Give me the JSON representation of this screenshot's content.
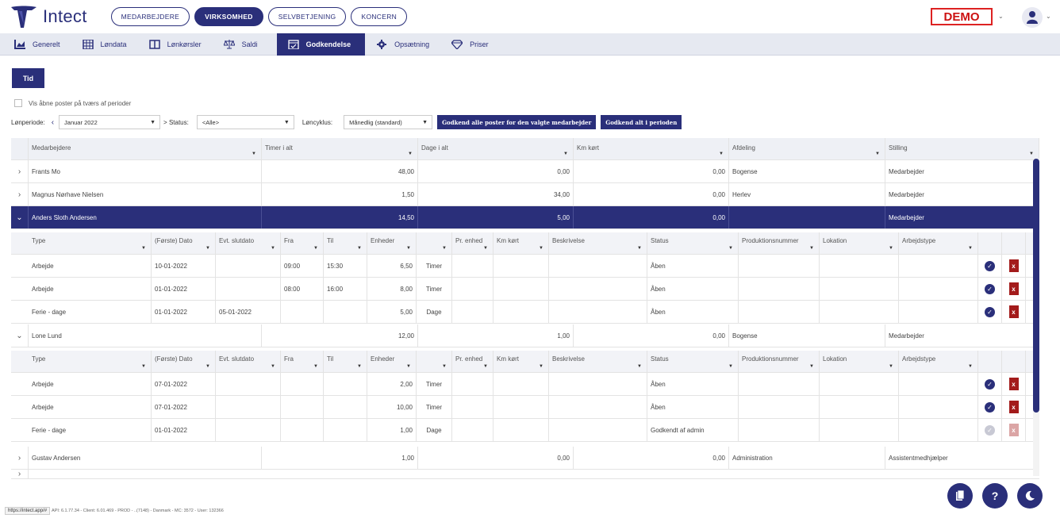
{
  "app": {
    "name": "Intect",
    "demo": "DEMO"
  },
  "top_tabs": [
    "MEDARBEJDERE",
    "VIRKSOMHED",
    "SELVBETJENING",
    "KONCERN"
  ],
  "nav": [
    {
      "label": "Generelt",
      "icon": "chart-icon"
    },
    {
      "label": "Løndata",
      "icon": "table-icon"
    },
    {
      "label": "Lønkørsler",
      "icon": "book-icon"
    },
    {
      "label": "Saldi",
      "icon": "scale-icon"
    },
    {
      "label": "Godkendelse",
      "icon": "calendar-check-icon",
      "active": true
    },
    {
      "label": "Opsætning",
      "icon": "gear-icon"
    },
    {
      "label": "Priser",
      "icon": "diamond-icon"
    }
  ],
  "tid_button": "Tid",
  "filters": {
    "cross_period_label": "Vis åbne poster på tværs af perioder",
    "period_label": "Lønperiode:",
    "period_value": "Januar 2022",
    "status_label": "> Status:",
    "status_value": "<Alle>",
    "cycle_label": "Løncyklus:",
    "cycle_value": "Månedlig (standard)",
    "approve_employee_btn": "Godkend alle poster for den valgte medarbejder",
    "approve_period_btn": "Godkend alt i perioden"
  },
  "grid_headers": [
    "Medarbejdere",
    "Timer i alt",
    "Dage i alt",
    "Km kørt",
    "Afdeling",
    "Stilling"
  ],
  "employees": [
    {
      "name": "Frants Mo",
      "hours": "48,00",
      "days": "0,00",
      "km": "0,00",
      "dept": "Bogense",
      "role": "Medarbejder"
    },
    {
      "name": "Magnus Nørhave Nielsen",
      "hours": "1,50",
      "days": "34,00",
      "km": "0,00",
      "dept": "Herlev",
      "role": "Medarbejder"
    },
    {
      "name": "Anders Sloth Andersen",
      "hours": "14,50",
      "days": "5,00",
      "km": "0,00",
      "dept": "",
      "role": "Medarbejder"
    },
    {
      "name": "Lone Lund",
      "hours": "12,00",
      "days": "1,00",
      "km": "0,00",
      "dept": "Bogense",
      "role": "Medarbejder"
    },
    {
      "name": "Gustav Andersen",
      "hours": "1,00",
      "days": "0,00",
      "km": "0,00",
      "dept": "Administration",
      "role": "Assistentmedhjælper"
    }
  ],
  "sub_headers": [
    "Type",
    "(Første) Dato",
    "Evt. slutdato",
    "Fra",
    "Til",
    "Enheder",
    "",
    "Pr. enhed",
    "Km kørt",
    "Beskrivelse",
    "Status",
    "Produktionsnummer",
    "Lokation",
    "Arbejdstype"
  ],
  "anders_entries": [
    {
      "type": "Arbejde",
      "date": "10-01-2022",
      "end": "",
      "from": "09:00",
      "to": "15:30",
      "units": "6,50",
      "unit": "Timer",
      "status": "Åben",
      "approved": false
    },
    {
      "type": "Arbejde",
      "date": "01-01-2022",
      "end": "",
      "from": "08:00",
      "to": "16:00",
      "units": "8,00",
      "unit": "Timer",
      "status": "Åben",
      "approved": false
    },
    {
      "type": "Ferie - dage",
      "date": "01-01-2022",
      "end": "05-01-2022",
      "from": "",
      "to": "",
      "units": "5,00",
      "unit": "Dage",
      "status": "Åben",
      "approved": false
    }
  ],
  "lone_entries": [
    {
      "type": "Arbejde",
      "date": "07-01-2022",
      "end": "",
      "from": "",
      "to": "",
      "units": "2,00",
      "unit": "Timer",
      "status": "Åben",
      "approved": false
    },
    {
      "type": "Arbejde",
      "date": "07-01-2022",
      "end": "",
      "from": "",
      "to": "",
      "units": "10,00",
      "unit": "Timer",
      "status": "Åben",
      "approved": false
    },
    {
      "type": "Ferie - dage",
      "date": "01-01-2022",
      "end": "",
      "from": "",
      "to": "",
      "units": "1,00",
      "unit": "Dage",
      "status": "Godkendt af admin",
      "approved": true
    }
  ],
  "footer": {
    "url": "https://intect.app/#",
    "info": "API: 6.1.77.34 - Client: 6.01.469 - PROD - ..(7148) - Danmark - MC: 3572 - User: 132366"
  }
}
